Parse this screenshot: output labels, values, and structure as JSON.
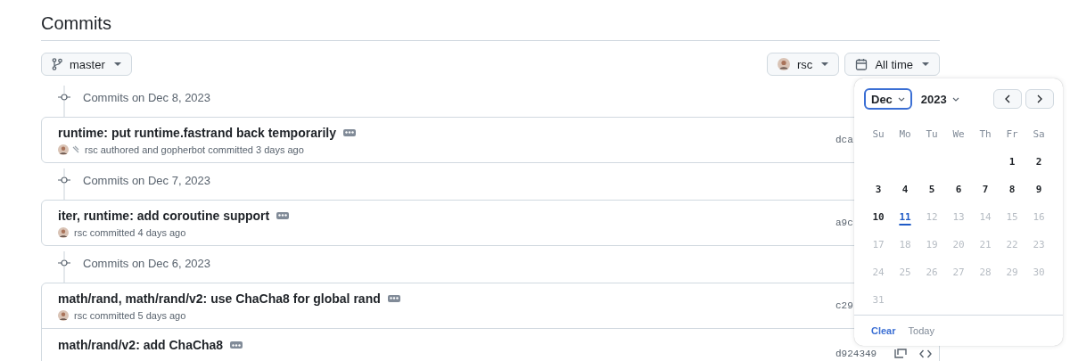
{
  "title": "Commits",
  "branch": {
    "label": "master"
  },
  "author_filter": {
    "label": "rsc"
  },
  "time_filter": {
    "label": "All time"
  },
  "groups": [
    {
      "heading": "Commits on Dec 8, 2023",
      "commits": [
        {
          "message": "runtime: put runtime.fastrand back temporarily",
          "byline": "rsc authored and gopherbot committed 3 days ago",
          "coauthor": true,
          "hash": "dca"
        }
      ]
    },
    {
      "heading": "Commits on Dec 7, 2023",
      "commits": [
        {
          "message": "iter, runtime: add coroutine support",
          "byline": "rsc committed 4 days ago",
          "coauthor": false,
          "hash": "a9c"
        }
      ]
    },
    {
      "heading": "Commits on Dec 6, 2023",
      "commits": [
        {
          "message": "math/rand, math/rand/v2: use ChaCha8 for global rand",
          "byline": "rsc committed 5 days ago",
          "coauthor": false,
          "hash": "c29"
        },
        {
          "message": "math/rand/v2: add ChaCha8",
          "hash": "d924349",
          "actions": true
        }
      ]
    }
  ],
  "calendar": {
    "month": "Dec",
    "year": "2023",
    "weekdays": [
      "Su",
      "Mo",
      "Tu",
      "We",
      "Th",
      "Fr",
      "Sa"
    ],
    "weeks": [
      [
        {
          "day": "1",
          "disabled": false,
          "today": false
        },
        {
          "day": "2",
          "disabled": false,
          "today": false
        }
      ],
      [
        {
          "day": "3",
          "disabled": false,
          "today": false
        },
        {
          "day": "4",
          "disabled": false,
          "today": false
        },
        {
          "day": "5",
          "disabled": false,
          "today": false
        },
        {
          "day": "6",
          "disabled": false,
          "today": false
        },
        {
          "day": "7",
          "disabled": false,
          "today": false
        },
        {
          "day": "8",
          "disabled": false,
          "today": false
        },
        {
          "day": "9",
          "disabled": false,
          "today": false
        }
      ],
      [
        {
          "day": "10",
          "disabled": false,
          "today": false
        },
        {
          "day": "11",
          "disabled": false,
          "today": true
        },
        {
          "day": "12",
          "disabled": true,
          "today": false
        },
        {
          "day": "13",
          "disabled": true,
          "today": false
        },
        {
          "day": "14",
          "disabled": true,
          "today": false
        },
        {
          "day": "15",
          "disabled": true,
          "today": false
        },
        {
          "day": "16",
          "disabled": true,
          "today": false
        }
      ],
      [
        {
          "day": "17",
          "disabled": true,
          "today": false
        },
        {
          "day": "18",
          "disabled": true,
          "today": false
        },
        {
          "day": "19",
          "disabled": true,
          "today": false
        },
        {
          "day": "20",
          "disabled": true,
          "today": false
        },
        {
          "day": "21",
          "disabled": true,
          "today": false
        },
        {
          "day": "22",
          "disabled": true,
          "today": false
        },
        {
          "day": "23",
          "disabled": true,
          "today": false
        }
      ],
      [
        {
          "day": "24",
          "disabled": true,
          "today": false
        },
        {
          "day": "25",
          "disabled": true,
          "today": false
        },
        {
          "day": "26",
          "disabled": true,
          "today": false
        },
        {
          "day": "27",
          "disabled": true,
          "today": false
        },
        {
          "day": "28",
          "disabled": true,
          "today": false
        },
        {
          "day": "29",
          "disabled": true,
          "today": false
        },
        {
          "day": "30",
          "disabled": true,
          "today": false
        }
      ],
      [
        {
          "day": "31",
          "disabled": true,
          "today": false
        }
      ]
    ],
    "footer": [
      {
        "label": "Clear",
        "kind": "primary"
      },
      {
        "label": "Today",
        "kind": "secondary"
      }
    ]
  }
}
